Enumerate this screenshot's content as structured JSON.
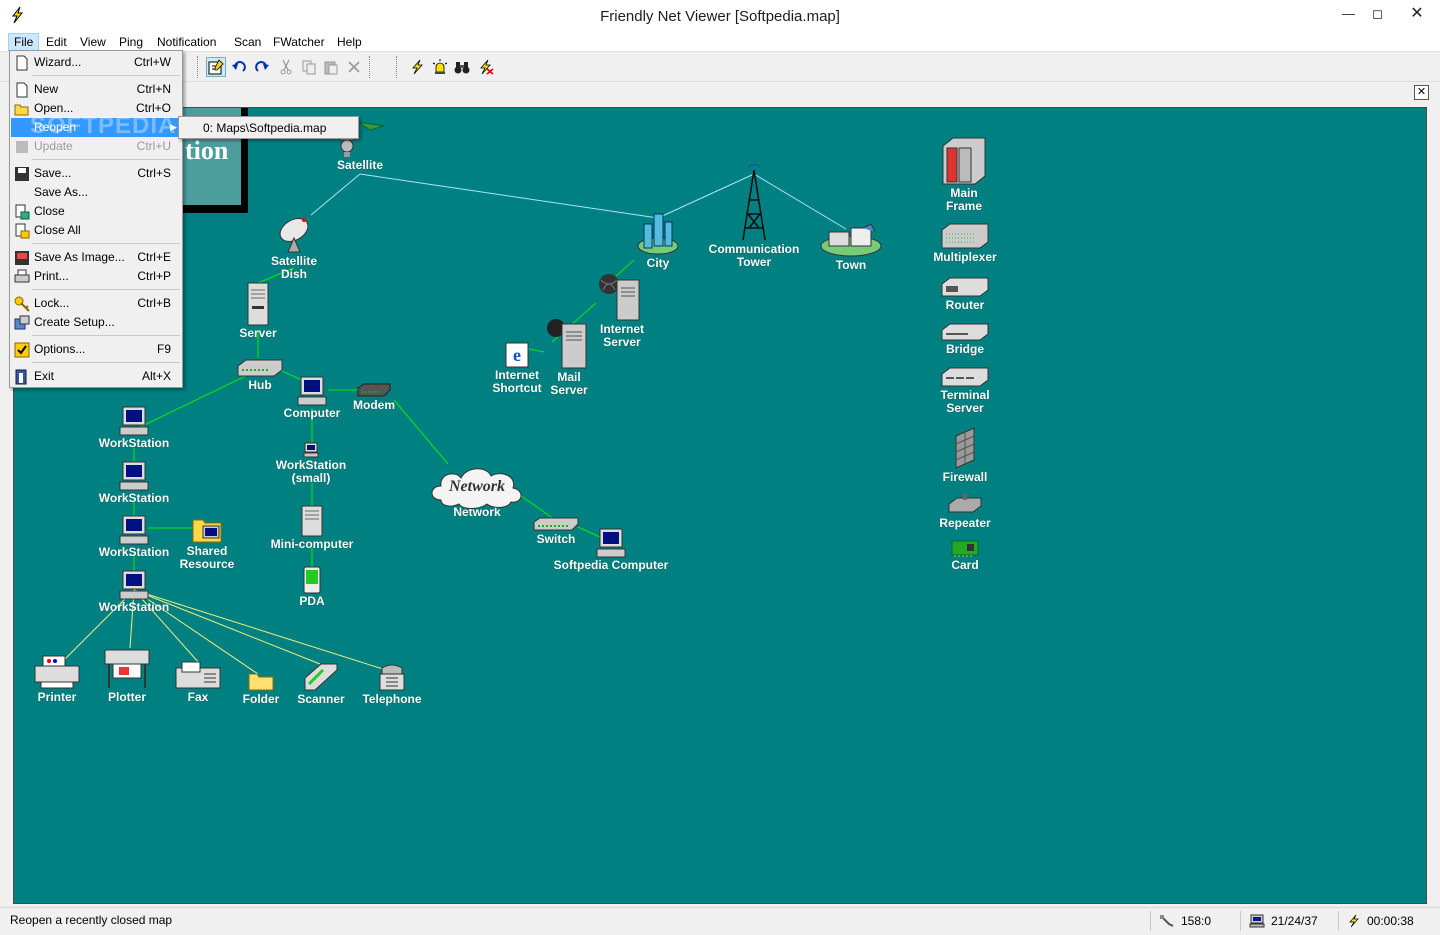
{
  "window": {
    "title": "Friendly Net Viewer [Softpedia.map]"
  },
  "menubar": [
    "File",
    "Edit",
    "View",
    "Ping",
    "Notification",
    "Scan",
    "FWatcher",
    "Help"
  ],
  "file_menu": [
    {
      "label": "Wizard...",
      "key": "Ctrl+W",
      "icon": "wizard-icon"
    },
    {
      "label": "New",
      "key": "Ctrl+N",
      "icon": "new-document-icon"
    },
    {
      "label": "Open...",
      "key": "Ctrl+O",
      "icon": "open-folder-icon"
    },
    {
      "label": "Reopen",
      "key": "",
      "icon": "",
      "selected": true
    },
    {
      "label": "Update",
      "key": "Ctrl+U",
      "icon": "update-icon",
      "disabled": true
    },
    {
      "label": "Save...",
      "key": "Ctrl+S",
      "icon": "save-icon"
    },
    {
      "label": "Save As...",
      "key": "",
      "icon": ""
    },
    {
      "label": "Close",
      "key": "",
      "icon": "close-map-icon"
    },
    {
      "label": "Close All",
      "key": "",
      "icon": "close-all-icon"
    },
    {
      "label": "Save As Image...",
      "key": "Ctrl+E",
      "icon": "save-image-icon"
    },
    {
      "label": "Print...",
      "key": "Ctrl+P",
      "icon": "print-icon"
    },
    {
      "label": "Lock...",
      "key": "Ctrl+B",
      "icon": "lock-icon"
    },
    {
      "label": "Create Setup...",
      "key": "",
      "icon": "setup-icon"
    },
    {
      "label": "Options...",
      "key": "F9",
      "icon": "options-icon"
    },
    {
      "label": "Exit",
      "key": "Alt+X",
      "icon": "exit-icon"
    }
  ],
  "reopen_submenu": {
    "item": "0: Maps\\Softpedia.map"
  },
  "watermark": "SOFTPEDIA",
  "map": {
    "title_card_text": "tion",
    "nodes": [
      {
        "id": "satellite",
        "label": "Satellite",
        "icon": "satellite-icon"
      },
      {
        "id": "satellite-dish",
        "label": "Satellite\nDish",
        "icon": "satellite-dish-icon"
      },
      {
        "id": "server",
        "label": "Server",
        "icon": "server-icon"
      },
      {
        "id": "hub",
        "label": "Hub",
        "icon": "hub-icon"
      },
      {
        "id": "computer",
        "label": "Computer",
        "icon": "computer-icon"
      },
      {
        "id": "modem",
        "label": "Modem",
        "icon": "modem-icon"
      },
      {
        "id": "ws1",
        "label": "WorkStation",
        "icon": "workstation-icon"
      },
      {
        "id": "ws2",
        "label": "WorkStation",
        "icon": "workstation-icon"
      },
      {
        "id": "ws3",
        "label": "WorkStation",
        "icon": "workstation-icon"
      },
      {
        "id": "ws4",
        "label": "WorkStation",
        "icon": "workstation-icon"
      },
      {
        "id": "shared",
        "label": "Shared\nResource",
        "icon": "shared-folder-icon"
      },
      {
        "id": "ws-small",
        "label": "WorkStation\n(small)",
        "icon": "small-workstation-icon"
      },
      {
        "id": "mini",
        "label": "Mini-computer",
        "icon": "minicomputer-icon"
      },
      {
        "id": "pda",
        "label": "PDA",
        "icon": "pda-icon"
      },
      {
        "id": "printer",
        "label": "Printer",
        "icon": "printer-icon"
      },
      {
        "id": "plotter",
        "label": "Plotter",
        "icon": "plotter-icon"
      },
      {
        "id": "fax",
        "label": "Fax",
        "icon": "fax-icon"
      },
      {
        "id": "folder",
        "label": "Folder",
        "icon": "folder-icon"
      },
      {
        "id": "scanner",
        "label": "Scanner",
        "icon": "scanner-icon"
      },
      {
        "id": "telephone",
        "label": "Telephone",
        "icon": "telephone-icon"
      },
      {
        "id": "network",
        "label": "Network",
        "icon": "cloud-icon",
        "cloud_text": "Network"
      },
      {
        "id": "switch",
        "label": "Switch",
        "icon": "switch-icon"
      },
      {
        "id": "softpedia",
        "label": "Softpedia Computer",
        "icon": "computer-icon"
      },
      {
        "id": "city",
        "label": "City",
        "icon": "city-icon"
      },
      {
        "id": "tower",
        "label": "Communication\nTower",
        "icon": "tower-icon"
      },
      {
        "id": "town",
        "label": "Town",
        "icon": "town-icon"
      },
      {
        "id": "inet-server",
        "label": "Internet\nServer",
        "icon": "internet-server-icon"
      },
      {
        "id": "mail",
        "label": "Mail\nServer",
        "icon": "mail-server-icon"
      },
      {
        "id": "shortcut",
        "label": "Internet\nShortcut",
        "icon": "internet-shortcut-icon"
      },
      {
        "id": "mainframe",
        "label": "Main\nFrame",
        "icon": "mainframe-icon"
      },
      {
        "id": "multiplexer",
        "label": "Multiplexer",
        "icon": "multiplexer-icon"
      },
      {
        "id": "router",
        "label": "Router",
        "icon": "router-icon"
      },
      {
        "id": "bridge",
        "label": "Bridge",
        "icon": "bridge-icon"
      },
      {
        "id": "terminal",
        "label": "Terminal\nServer",
        "icon": "terminal-server-icon"
      },
      {
        "id": "firewall",
        "label": "Firewall",
        "icon": "firewall-icon"
      },
      {
        "id": "repeater",
        "label": "Repeater",
        "icon": "repeater-icon"
      },
      {
        "id": "card",
        "label": "Card",
        "icon": "network-card-icon"
      }
    ]
  },
  "status": {
    "message": "Reopen a recently closed map",
    "ping": "158:0",
    "hosts": "21/24/37",
    "timer": "00:00:38"
  },
  "colors": {
    "canvas": "#008080",
    "link_green": "#00ff00",
    "link_lightblue": "#a0e8ff",
    "link_yellow": "#ffff80",
    "menu_highlight": "#3399ff"
  }
}
